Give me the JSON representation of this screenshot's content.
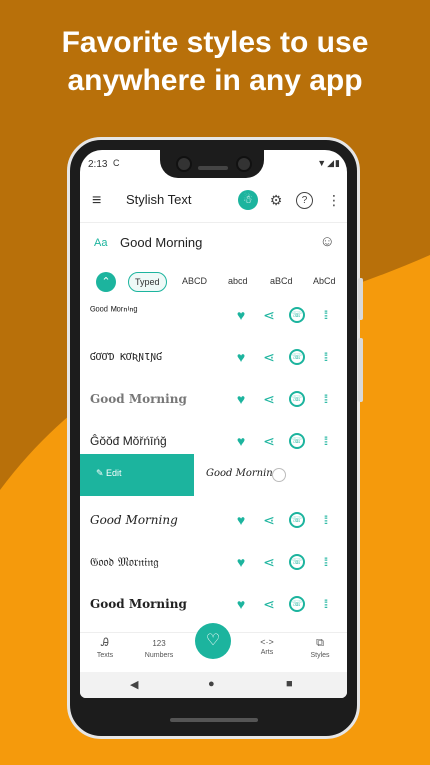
{
  "headline": [
    "Favorite styles to use",
    "anywhere in any app"
  ],
  "status": {
    "time": "2:13",
    "icon": "C",
    "right": "▼◢▮"
  },
  "appbar": {
    "title": "Stylish Text",
    "menu_icon": "≡",
    "icons": [
      "☃",
      "⚙",
      "?",
      "⋮"
    ]
  },
  "input": {
    "prefix": "Aa",
    "value": "Good Morning"
  },
  "chips": [
    "Typed",
    "ABCD",
    "abcd",
    "aBCd",
    "AbCd"
  ],
  "styles": [
    {
      "text": "ᴳᵒᵒᵈ ᴹᵒʳⁿⁱⁿᵍ"
    },
    {
      "text": "ƓƠƠƊ ƘƠƦƝƖƝƓ"
    },
    {
      "text": "Good Morning"
    },
    {
      "text": "Ĝŏŏđ Mŏřńīńğ"
    },
    {
      "text": "Good Morning"
    },
    {
      "text": "𝔊𝔬𝔬𝔡 𝔐𝔬𝔯𝔫𝔦𝔫𝔤"
    },
    {
      "text": "Good Morning"
    }
  ],
  "swipe": {
    "edit_label": "Edit",
    "preview": "Good Morning"
  },
  "actions": {
    "heart": "♥",
    "share": "⋖",
    "whatsapp": "☏",
    "drag": "⁞⁞"
  },
  "nav": [
    {
      "icon": "Ꭿ",
      "label": "Texts"
    },
    {
      "icon": "123",
      "label": "Numbers"
    },
    {
      "icon": "<·>",
      "label": "Arts"
    },
    {
      "icon": "⧉",
      "label": "Styles"
    }
  ],
  "fab_icon": "♡",
  "sysnav": {
    "back": "◀",
    "home": "●",
    "recent": "■"
  }
}
